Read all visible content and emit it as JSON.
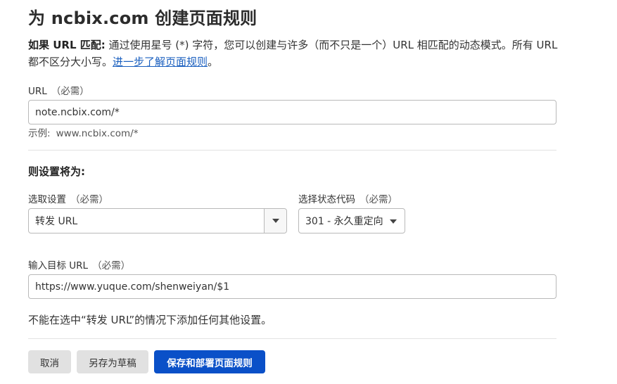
{
  "page": {
    "title": "为 ncbix.com 创建页面规则"
  },
  "description": {
    "lead": "如果 URL 匹配:",
    "body": "通过使用星号 (*) 字符，您可以创建与许多（而不只是一个）URL 相匹配的动态模式。所有 URL 都不区分大小写。",
    "link": "进一步了解页面规则",
    "tail": "。"
  },
  "url_field": {
    "label": "URL",
    "required": "（必需）",
    "value": "note.ncbix.com/*",
    "hint_prefix": "示例:",
    "hint_value": "www.ncbix.com/*"
  },
  "settings": {
    "section_title": "则设置将为:",
    "setting_select": {
      "label": "选取设置",
      "required": "（必需）",
      "value": "转发 URL"
    },
    "status_select": {
      "label": "选择状态代码",
      "required": "（必需）",
      "value": "301 - 永久重定向"
    },
    "target_field": {
      "label": "输入目标 URL",
      "required": "（必需）",
      "value": "https://www.yuque.com/shenweiyan/$1"
    },
    "note": "不能在选中“转发 URL”的情况下添加任何其他设置。"
  },
  "actions": {
    "cancel": "取消",
    "save_draft": "另存为草稿",
    "save_deploy": "保存和部署页面规则"
  },
  "colors": {
    "primary": "#0a50c8",
    "link": "#1a5fbf",
    "secondary_button": "#e1e1e1"
  }
}
